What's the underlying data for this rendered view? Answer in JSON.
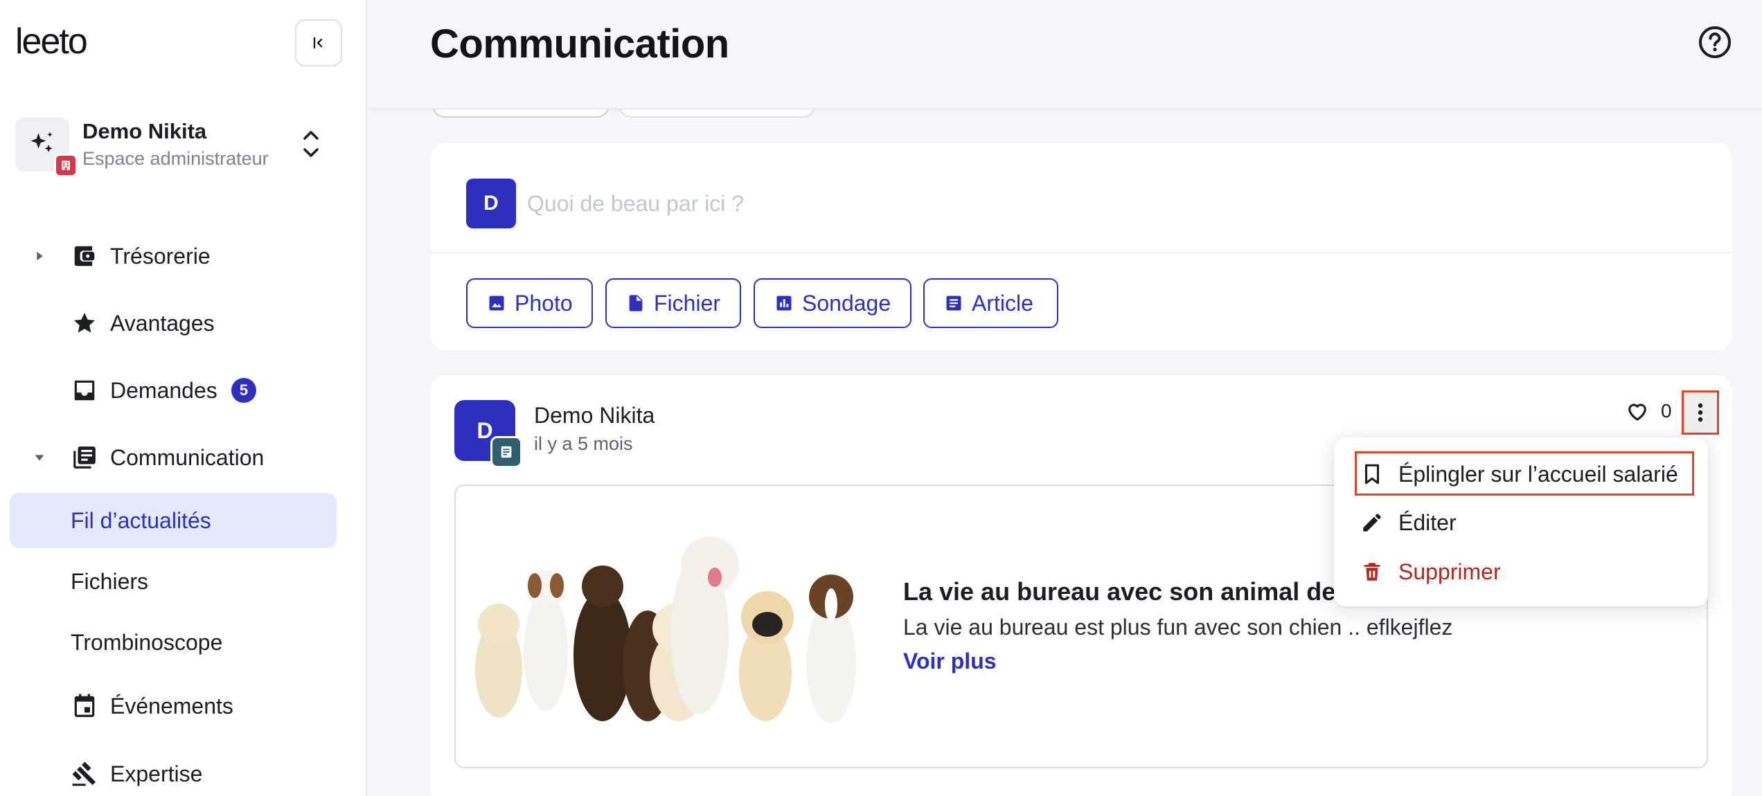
{
  "app": {
    "logo": "leeto"
  },
  "workspace": {
    "name": "Demo Nikita",
    "subtitle": "Espace administrateur"
  },
  "sidebar": {
    "items": [
      {
        "label": "Trésorerie",
        "icon": "wallet-icon",
        "caret": "collapsed"
      },
      {
        "label": "Avantages",
        "icon": "star-icon"
      },
      {
        "label": "Demandes",
        "icon": "inbox-icon",
        "badge": "5"
      },
      {
        "label": "Communication",
        "icon": "news-icon",
        "caret": "expanded"
      }
    ],
    "sub_items": [
      {
        "label": "Fil d’actualités",
        "active": true
      },
      {
        "label": "Fichiers"
      },
      {
        "label": "Trombinoscope"
      }
    ],
    "more_items": [
      {
        "label": "Événements",
        "icon": "calendar-icon"
      },
      {
        "label": "Expertise",
        "icon": "gavel-icon"
      }
    ]
  },
  "header": {
    "title": "Communication"
  },
  "composer": {
    "avatar_initial": "D",
    "placeholder": "Quoi de beau par ici ?",
    "buttons": [
      "Photo",
      "Fichier",
      "Sondage",
      "Article"
    ]
  },
  "post": {
    "avatar_initial": "D",
    "author": "Demo Nikita",
    "time": "il y a 5 mois",
    "likes": "0",
    "article": {
      "title": "La vie au bureau avec son animal de c",
      "description": "La vie au bureau est plus fun avec son chien .. eflkejflez",
      "more": "Voir plus"
    }
  },
  "menu": {
    "items": [
      {
        "label": "Éplingler sur l’accueil salarié",
        "icon": "bookmark-icon"
      },
      {
        "label": "Éditer",
        "icon": "pencil-icon"
      },
      {
        "label": "Supprimer",
        "icon": "trash-icon"
      }
    ]
  },
  "colors": {
    "primary": "#2d2fbf",
    "active_bg": "#e3e8fb",
    "danger": "#b3261e",
    "highlight": "#e0442c"
  }
}
